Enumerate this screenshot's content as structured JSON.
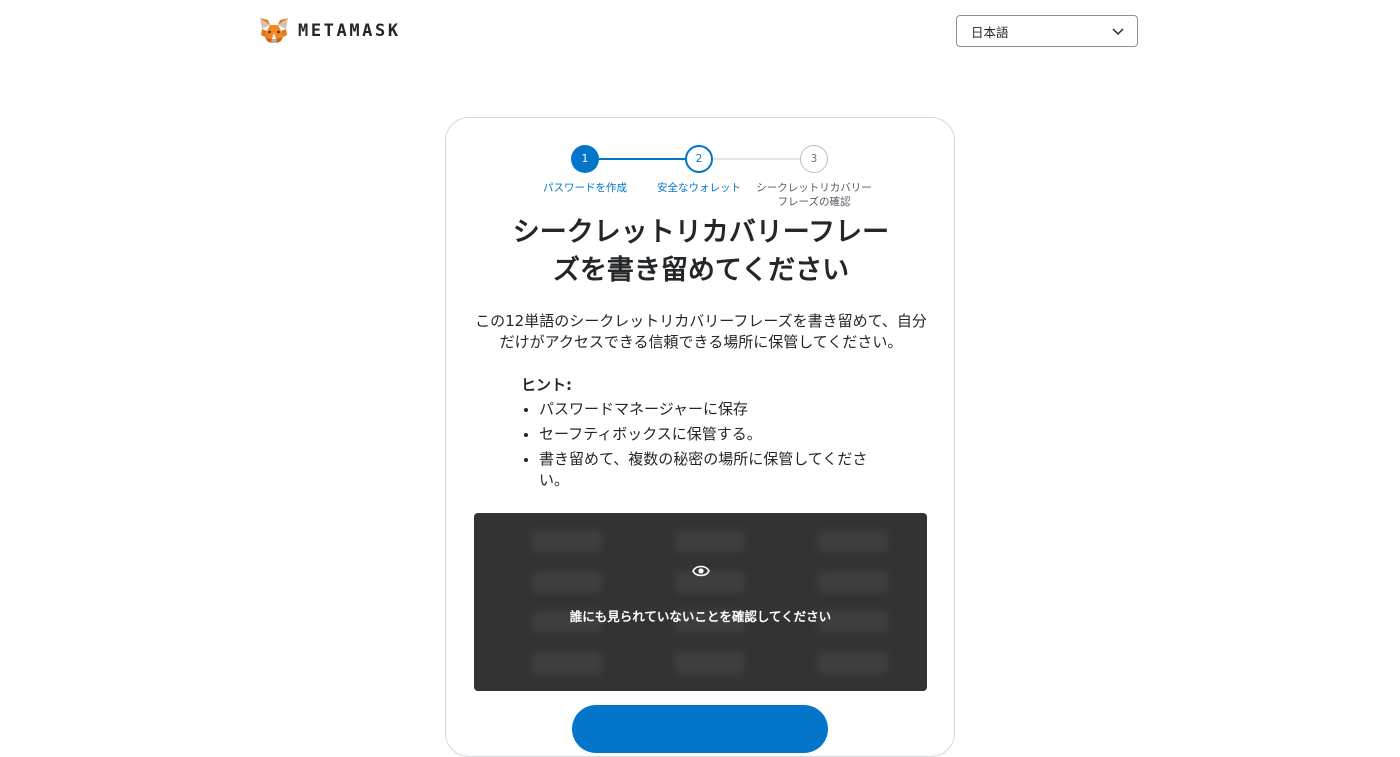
{
  "header": {
    "brand": "METAMASK",
    "language": {
      "selected": "日本語"
    }
  },
  "stepper": {
    "steps": [
      {
        "number": "1",
        "label": "パスワードを作成"
      },
      {
        "number": "2",
        "label": "安全なウォレット"
      },
      {
        "number": "3",
        "label": "シークレットリカバリーフレーズの確認"
      }
    ]
  },
  "main": {
    "title": "シークレットリカバリーフレーズを書き留めてください",
    "description": "この12単語のシークレットリカバリーフレーズを書き留めて、自分だけがアクセスできる信頼できる場所に保管してください。",
    "tips_title": "ヒント:",
    "tips": [
      "パスワードマネージャーに保存",
      "セーフティボックスに保管する。",
      "書き留めて、複数の秘密の場所に保管してください。"
    ],
    "reveal_text": "誰にも見られていないことを確認してください",
    "cta_label": ""
  },
  "colors": {
    "primary": "#0376c9",
    "overlay": "#333333",
    "text": "#24272a"
  }
}
